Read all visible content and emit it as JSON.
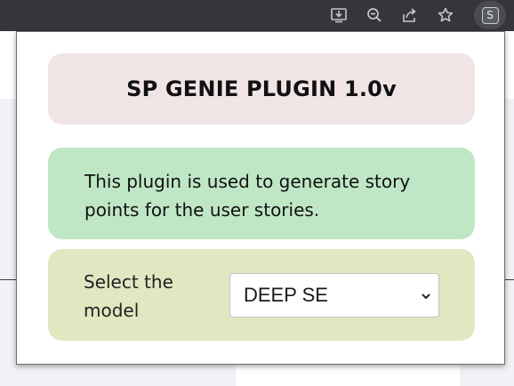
{
  "browser": {
    "toolbar_icons": [
      "install-icon",
      "zoom-out-icon",
      "share-icon",
      "bookmark-star-icon"
    ],
    "extension_badge": "S"
  },
  "popup": {
    "title": "SP GENIE PLUGIN 1.0v",
    "description": "This plugin is used to generate story points for the user stories.",
    "model_label": "Select the model",
    "model_selected": "DEEP SE"
  },
  "colors": {
    "toolbar": "#35363a",
    "title_card": "#f1e4e4",
    "info_card": "#c0e7c5",
    "select_card": "#e3e7c1"
  }
}
